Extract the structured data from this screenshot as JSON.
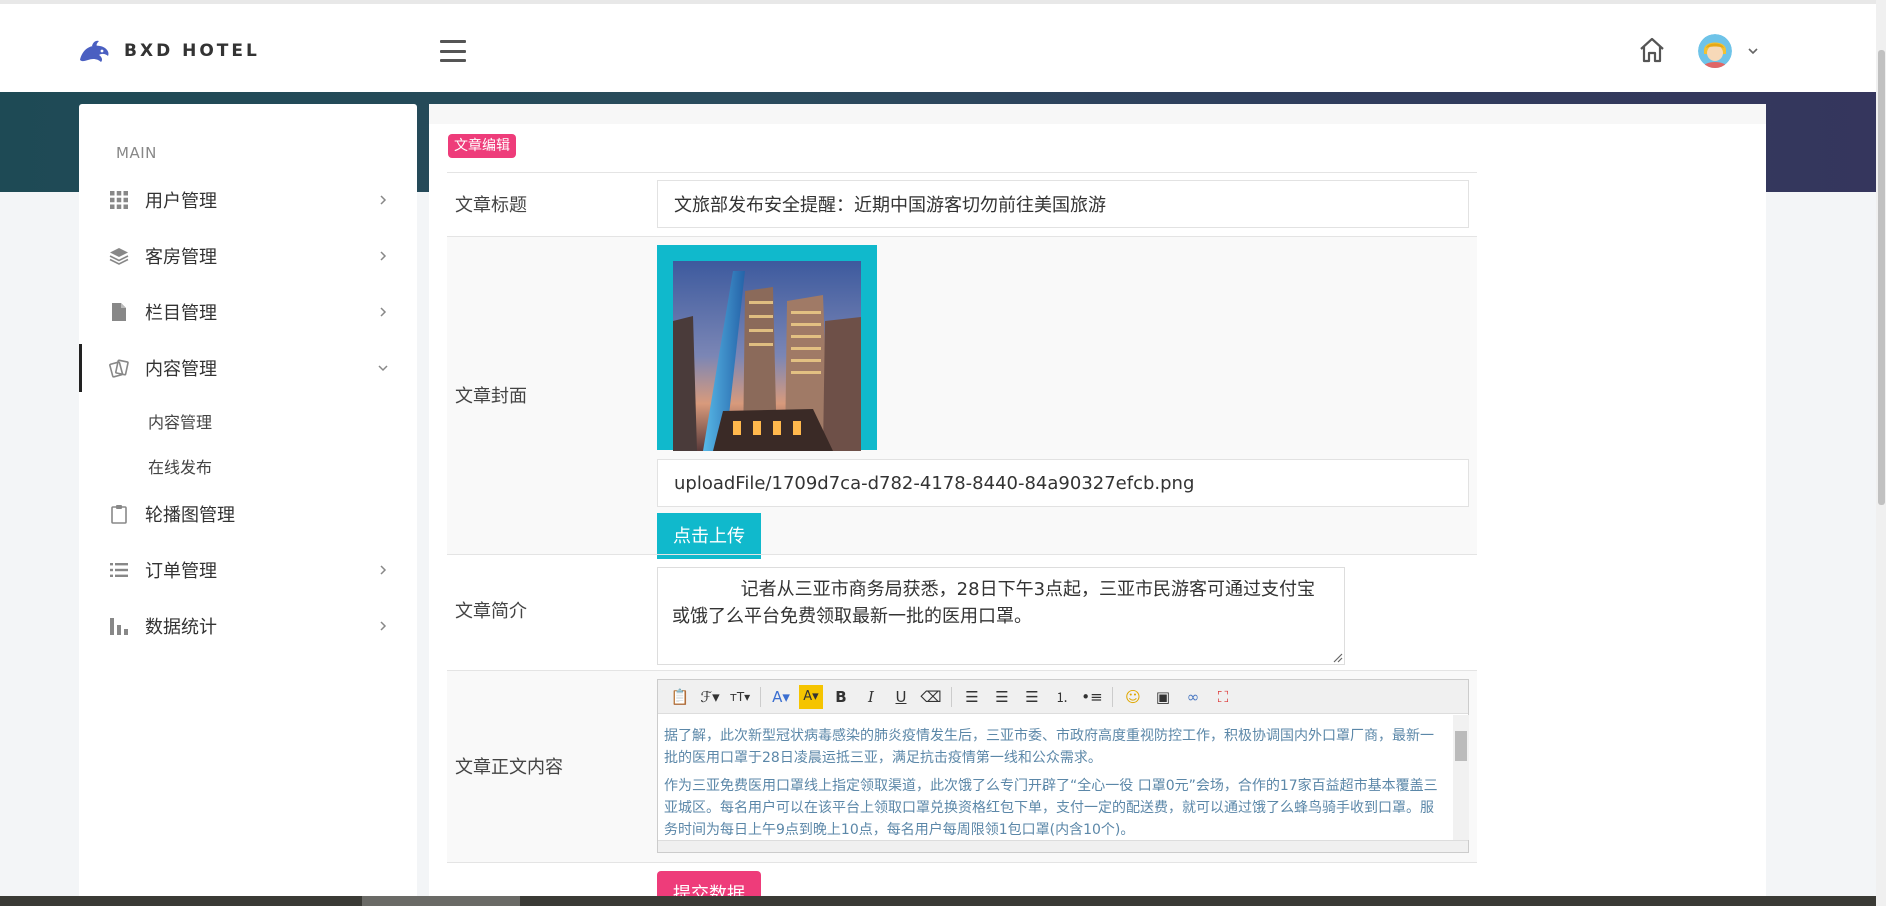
{
  "header": {
    "brand_name": "BXD HOTEL"
  },
  "sidebar": {
    "section_label": "MAIN",
    "items": [
      {
        "label": "用户管理",
        "icon": "grid-icon"
      },
      {
        "label": "客房管理",
        "icon": "layers-icon"
      },
      {
        "label": "栏目管理",
        "icon": "file-icon"
      },
      {
        "label": "内容管理",
        "icon": "cards-icon",
        "expanded": true
      },
      {
        "label": "轮播图管理",
        "icon": "clipboard-icon"
      },
      {
        "label": "订单管理",
        "icon": "list-icon"
      },
      {
        "label": "数据统计",
        "icon": "bar-chart-icon"
      }
    ],
    "sub_items": [
      "内容管理",
      "在线发布"
    ]
  },
  "form": {
    "tag": "文章编辑",
    "title_label": "文章标题",
    "title_value": "文旅部发布安全提醒：近期中国游客切勿前往美国旅游",
    "cover_label": "文章封面",
    "cover_path": "uploadFile/1709d7ca-d782-4178-8440-84a90327efcb.png",
    "upload_button": "点击上传",
    "summary_label": "文章简介",
    "summary_value": "            记者从三亚市商务局获悉，28日下午3点起，三亚市民游客可通过支付宝或饿了么平台免费领取最新一批的医用口罩。",
    "body_label": "文章正文内容",
    "body_paragraphs": [
      "据了解，此次新型冠状病毒感染的肺炎疫情发生后，三亚市委、市政府高度重视防控工作，积极协调国内外口罩厂商，最新一批的医用口罩于28日凌晨运抵三亚，满足抗击疫情第一线和公众需求。",
      "作为三亚免费医用口罩线上指定领取渠道，此次饿了么专门开辟了“全心一役 口罩0元”会场，合作的17家百益超市基本覆盖三亚城区。每名用户可以在该平台上领取口罩兑换资格红包下单，支付一定的配送费，就可以通过饿了么蜂鸟骑手收到口罩。服务时间为每日上午9点到晚上10点，每名用户每周限领1包口罩(内含10个)。"
    ],
    "submit_button": "提交数据"
  }
}
